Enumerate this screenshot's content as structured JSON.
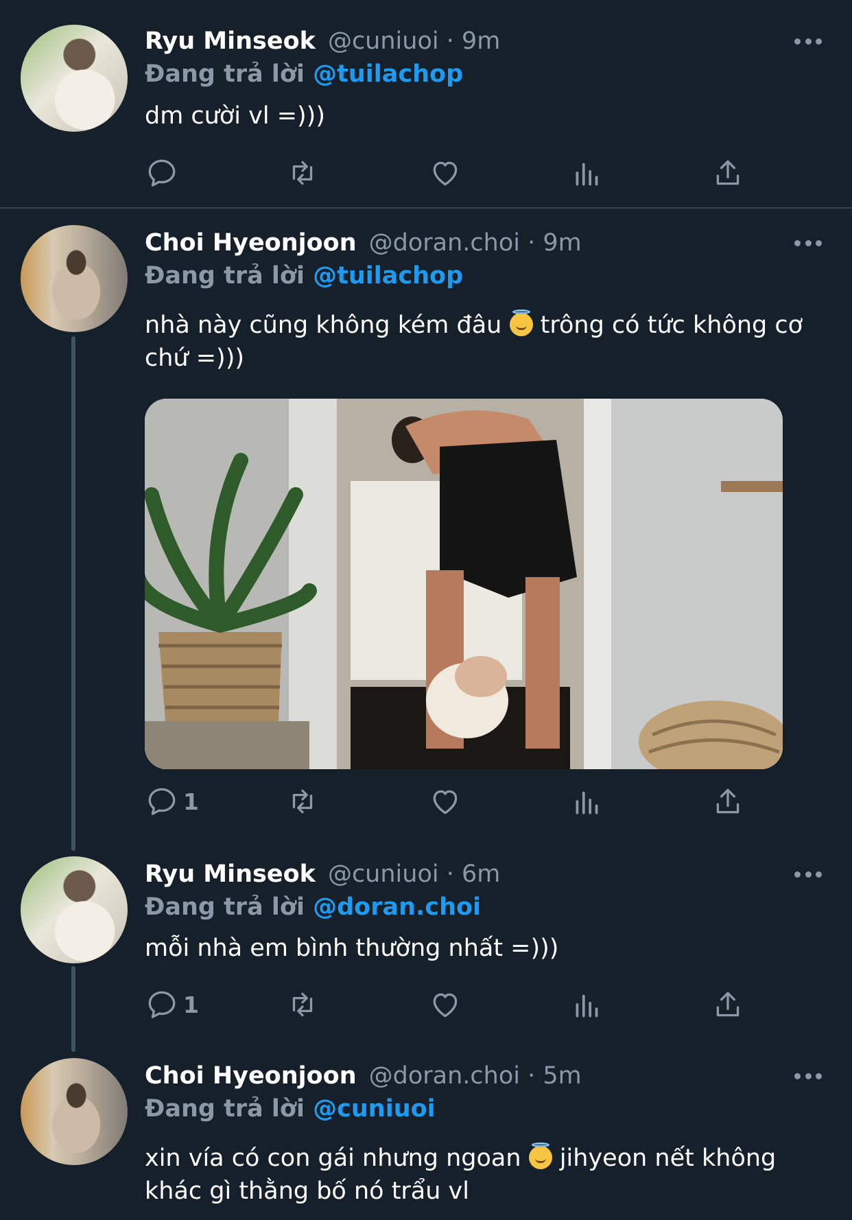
{
  "tweets": [
    {
      "name": "Ryu Minseok",
      "meta": "@cuniuoi · 9m",
      "replying_prefix": "Đang trả lời",
      "replying_to": "@tuilachop",
      "text": "dm cười vl =)))",
      "reply_count": ""
    },
    {
      "name": "Choi Hyeonjoon",
      "meta": "@doran.choi · 9m",
      "replying_prefix": "Đang trả lời",
      "replying_to": "@tuilachop",
      "text_before_emoji": "nhà này cũng không kém đâu",
      "text_after_emoji": "trông có tức không cơ chứ =)))",
      "emoji": "smiling-face-with-halo",
      "photo_alt": "photo",
      "reply_count": "1"
    },
    {
      "name": "Ryu Minseok",
      "meta": "@cuniuoi · 6m",
      "replying_prefix": "Đang trả lời",
      "replying_to": "@doran.choi",
      "text": "mỗi nhà em bình thường nhất =)))",
      "reply_count": "1"
    },
    {
      "name": "Choi Hyeonjoon",
      "meta": "@doran.choi · 5m",
      "replying_prefix": "Đang trả lời",
      "replying_to": "@cuniuoi",
      "text_before_emoji": "xin vía có con gái nhưng ngoan",
      "text_after_emoji": "jihyeon nết không khác gì thằng bố nó trẩu vl",
      "emoji": "smiling-face-with-halo"
    }
  ],
  "colors": {
    "background": "#15202b",
    "secondary_text": "#8b98a5",
    "accent": "#1d9bf0",
    "divider": "#38444d"
  },
  "icons": [
    "reply-icon",
    "retweet-icon",
    "like-icon",
    "analytics-icon",
    "share-icon",
    "more-icon"
  ]
}
